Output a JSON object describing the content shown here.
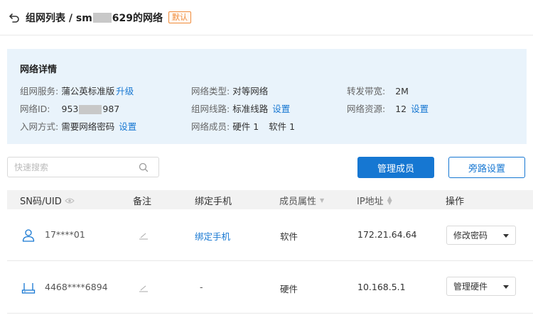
{
  "header": {
    "breadcrumb_prefix": "组网列表 / sm",
    "breadcrumb_suffix": "629的网络",
    "default_badge": "默认"
  },
  "details": {
    "title": "网络详情",
    "service_label": "组网服务:",
    "service_value": "蒲公英标准版",
    "service_link": "升级",
    "type_label": "网络类型:",
    "type_value": "对等网络",
    "bandwidth_label": "转发带宽:",
    "bandwidth_value": "2M",
    "id_label": "网络ID:",
    "id_prefix": "953",
    "id_suffix": "987",
    "line_label": "组网线路:",
    "line_value": "标准线路",
    "line_link": "设置",
    "resource_label": "网络资源:",
    "resource_value": "12",
    "resource_link": "设置",
    "join_label": "入网方式:",
    "join_value": "需要网络密码",
    "join_link": "设置",
    "members_label": "网络成员:",
    "hardware_value": "硬件 1",
    "software_value": "软件 1"
  },
  "toolbar": {
    "search_placeholder": "快速搜索",
    "manage_members": "管理成员",
    "bypass_settings": "旁路设置"
  },
  "table": {
    "columns": {
      "sn": "SN码/UID",
      "note": "备注",
      "phone": "绑定手机",
      "attr": "成员属性",
      "ip": "IP地址",
      "action": "操作"
    },
    "rows": [
      {
        "sn": "17****01",
        "phone": "绑定手机",
        "attr": "软件",
        "ip": "172.21.64.64",
        "action": "修改密码",
        "icon": "user-icon"
      },
      {
        "sn": "4468****6894",
        "phone": "-",
        "attr": "硬件",
        "ip": "10.168.5.1",
        "action": "管理硬件",
        "icon": "router-icon"
      }
    ]
  },
  "colors": {
    "accent": "#1677d2",
    "badge": "#f08c3c",
    "panel_bg": "#e9f3fb"
  }
}
